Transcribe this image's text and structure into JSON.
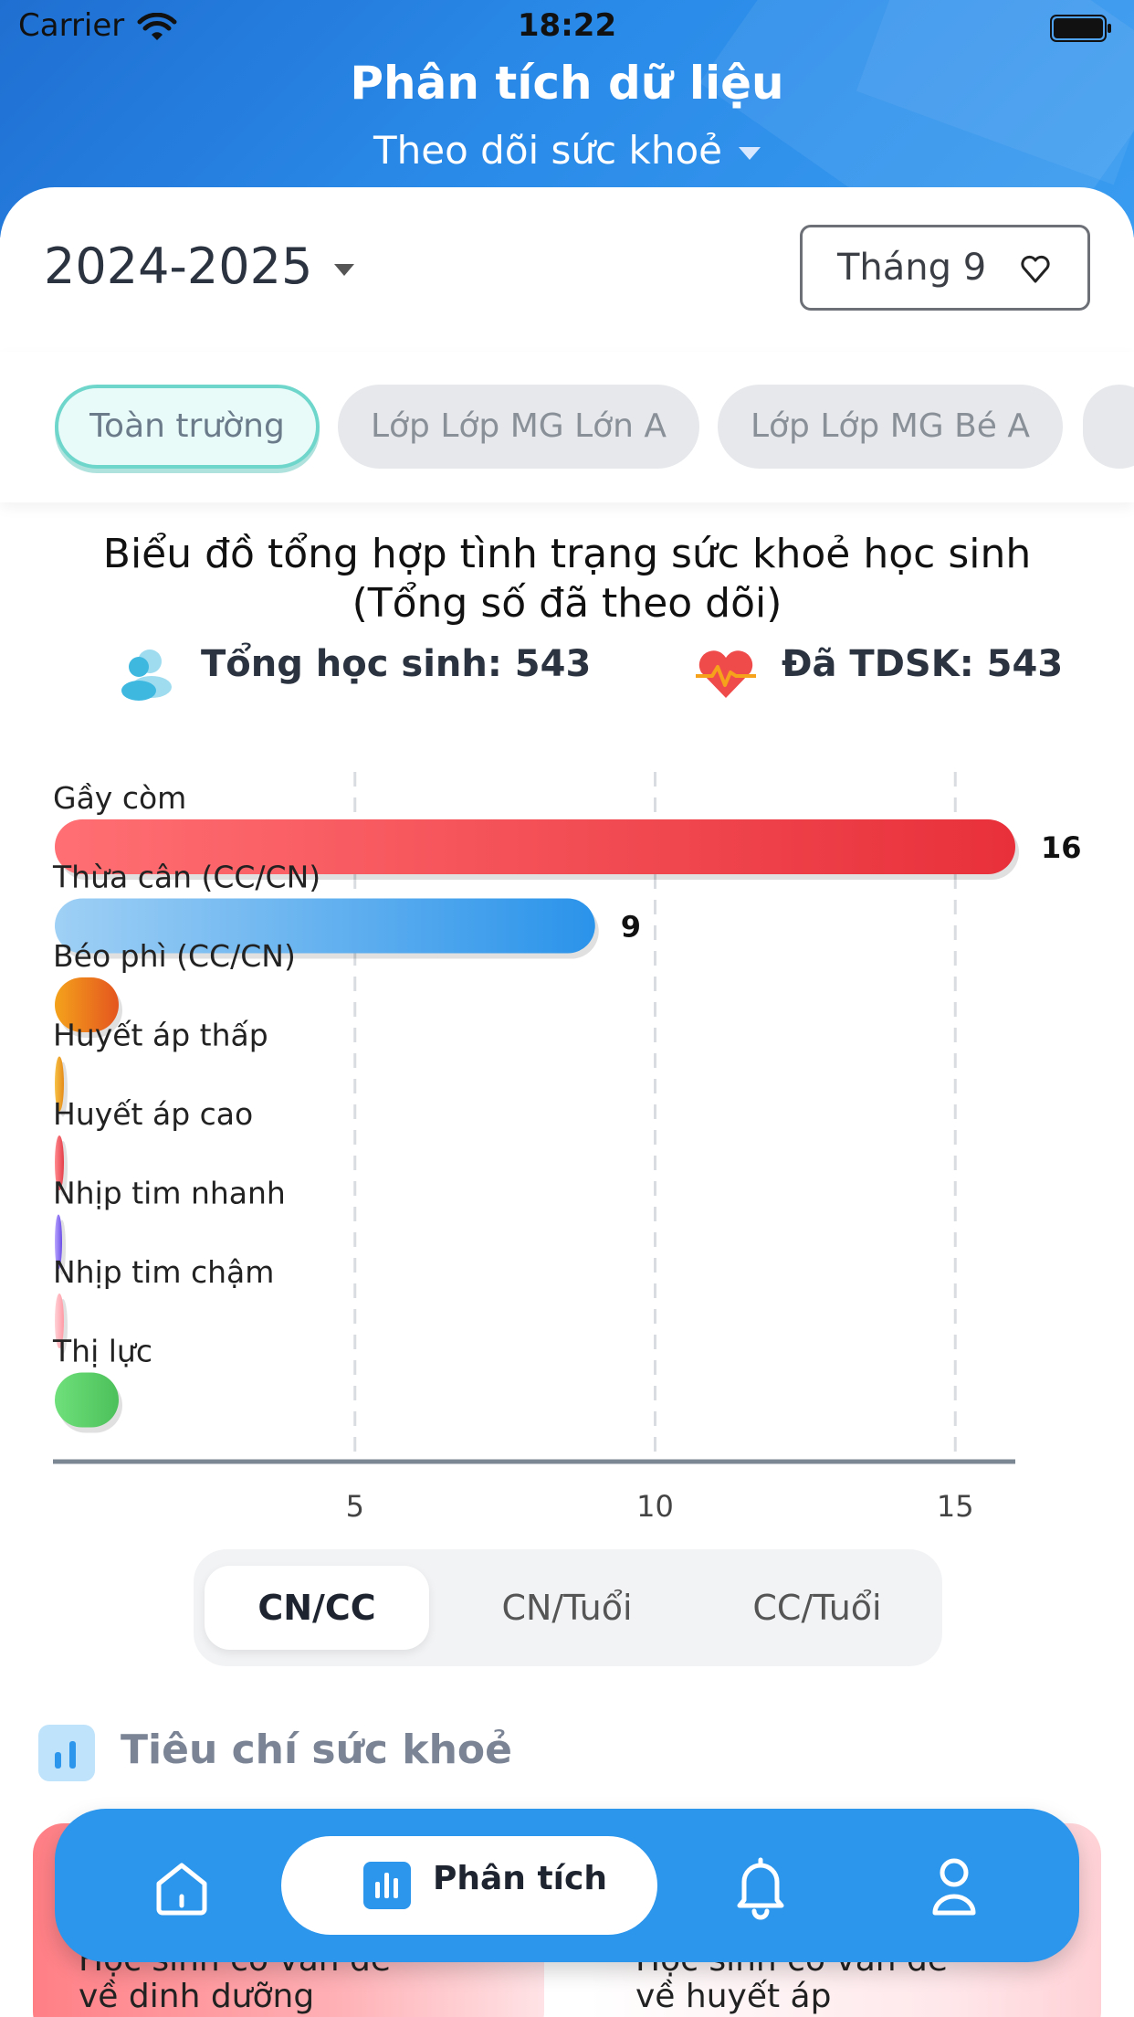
{
  "status_bar": {
    "carrier": "Carrier",
    "time": "18:22"
  },
  "header": {
    "title": "Phân tích dữ liệu",
    "subtitle": "Theo dõi sức khoẻ"
  },
  "filters": {
    "year": "2024-2025",
    "month": "Tháng 9"
  },
  "tabs": [
    {
      "label": "Toàn trường",
      "active": true
    },
    {
      "label": "Lớp Lớp MG Lớn A",
      "active": false
    },
    {
      "label": "Lớp Lớp MG Bé A",
      "active": false
    }
  ],
  "chart_section": {
    "title_line1": "Biểu đồ tổng hợp tình trạng sức khoẻ học sinh",
    "title_line2": "(Tổng số đã theo dõi)",
    "total_students": "Tổng học sinh: 543",
    "tracked": "Đã TDSK: 543"
  },
  "chart_data": {
    "type": "bar",
    "orientation": "horizontal",
    "categories": [
      "Gầy còm",
      "Thừa cân (CC/CN)",
      "Béo phì (CC/CN)",
      "Huyết áp thấp",
      "Huyết áp cao",
      "Nhịp tim nhanh",
      "Nhịp tim chậm",
      "Thị lực"
    ],
    "values": [
      16,
      9,
      0,
      0,
      0,
      0,
      0,
      0
    ],
    "data_labels": [
      "16",
      "9",
      "",
      "",
      "",
      "",
      "",
      ""
    ],
    "colors": [
      [
        "#ff6f73",
        "#e8303a"
      ],
      [
        "#9fd0f5",
        "#2a93ea"
      ],
      [
        "#f4a21b",
        "#e4551f"
      ],
      [
        "#f7c144",
        "#e58b1a"
      ],
      [
        "#ff8b90",
        "#e43e48"
      ],
      [
        "#b9a6ff",
        "#6b4ee6"
      ],
      [
        "#ffd1d6",
        "#ff9aa5"
      ],
      [
        "#6fe07b",
        "#4cc05a"
      ]
    ],
    "x_ticks": [
      5,
      10,
      15
    ],
    "xlim": [
      0,
      16
    ],
    "grid": true
  },
  "segmented": [
    {
      "label": "CN/CC",
      "active": true
    },
    {
      "label": "CN/Tuổi",
      "active": false
    },
    {
      "label": "CC/Tuổi",
      "active": false
    }
  ],
  "section": {
    "title": "Tiêu chí sức khoẻ"
  },
  "mini_cards": [
    {
      "line1": "Học sinh có vấn đề",
      "line2": "về dinh dưỡng"
    },
    {
      "line1": "Học sinh có vấn đề",
      "line2": "về huyết áp"
    }
  ],
  "bottom_nav": {
    "items": [
      {
        "icon": "home-icon"
      },
      {
        "icon": "chart-icon",
        "label": "Phân tích",
        "active": true
      },
      {
        "icon": "bell-icon"
      },
      {
        "icon": "user-icon"
      }
    ]
  }
}
